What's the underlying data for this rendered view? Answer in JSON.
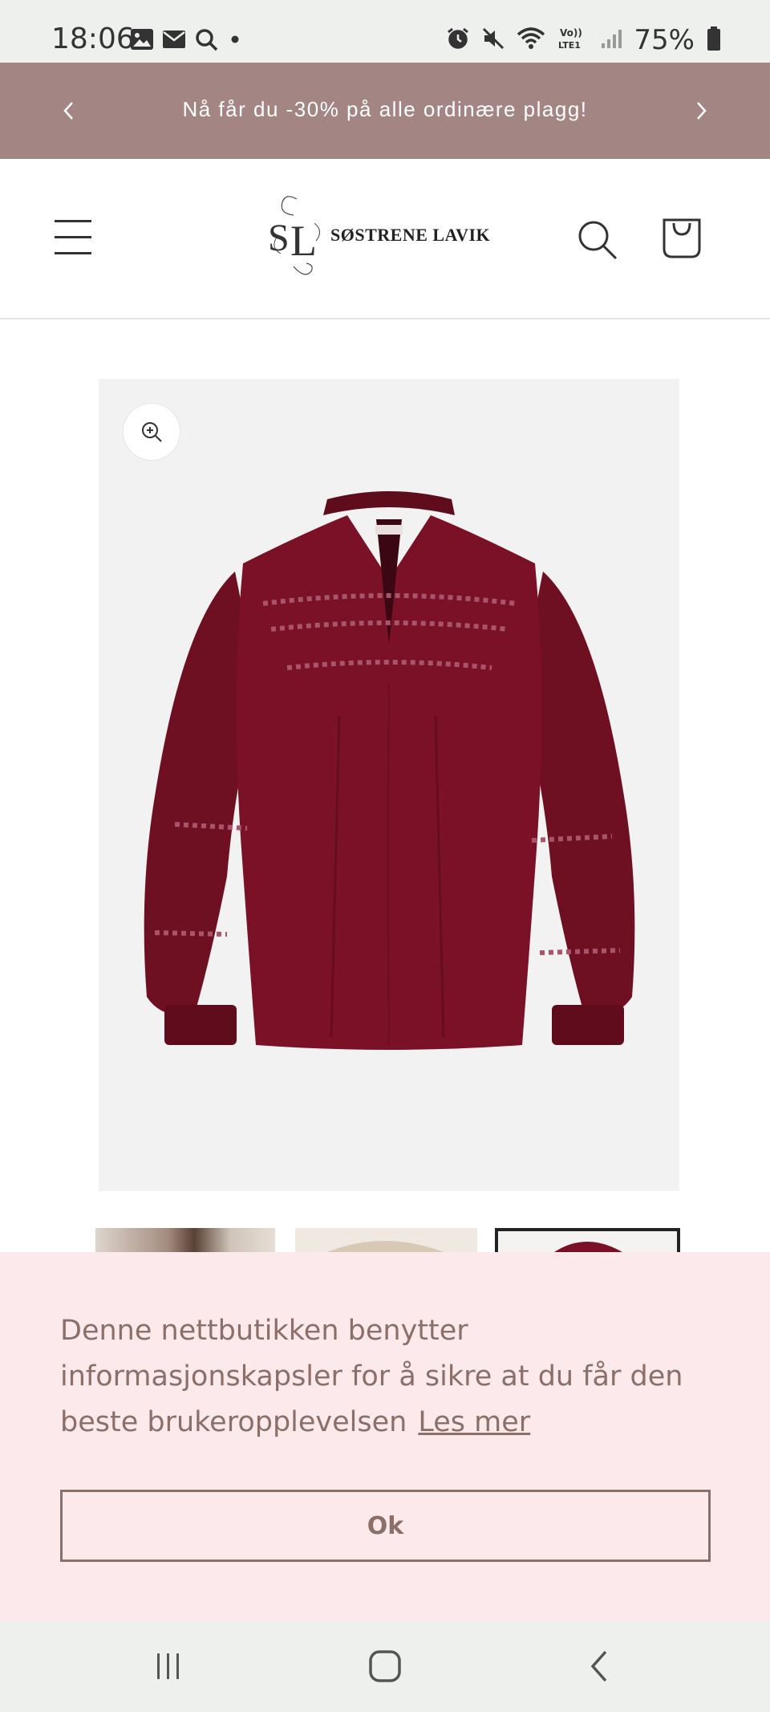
{
  "status_bar": {
    "time": "18:06",
    "battery": "75%",
    "left_icons": [
      "gallery-icon",
      "mail-icon",
      "search-icon",
      "dot-icon"
    ],
    "right_icons": [
      "alarm-icon",
      "mute-icon",
      "wifi-icon",
      "volte-icon",
      "signal-icon",
      "battery-icon"
    ],
    "volte_label": "Vo)) LTE1"
  },
  "announcement": {
    "text": "Nå får du -30% på alle ordinære plagg!"
  },
  "header": {
    "logo_monogram": "SL",
    "logo_text": "SØSTRENE LAVIK"
  },
  "product": {
    "image_description_icon": "blouse-image",
    "garment_color": "#7a1127"
  },
  "thumbnails": [
    {
      "name": "thumbnail-model"
    },
    {
      "name": "thumbnail-detail"
    },
    {
      "name": "thumbnail-blouse"
    }
  ],
  "cookie": {
    "text": "Denne nettbutikken benytter informasjonskapsler for å sikre at du får den beste brukeropplevelsen",
    "link_label": "Les mer",
    "ok_label": "Ok"
  },
  "colors": {
    "announcement_bg": "#a38583",
    "cookie_bg": "#fce9eb",
    "cookie_text": "#8b6f68"
  }
}
